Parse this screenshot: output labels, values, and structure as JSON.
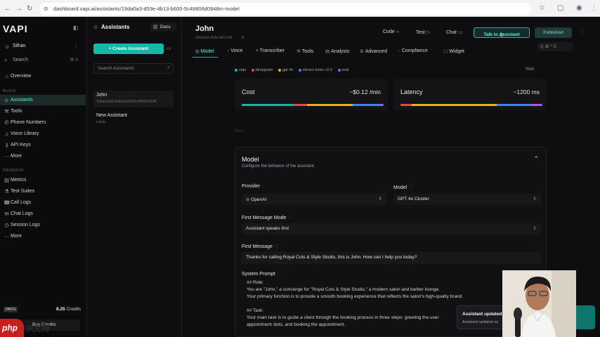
{
  "browser": {
    "url": "dashboard.vapi.ai/assistants/19da0a3-d53e-4b13-b600-5c48806d0948m-model"
  },
  "sidebar": {
    "logo": "VAPI",
    "org_name": "Sifran",
    "search_label": "Search",
    "search_shortcut": "⌘ K",
    "items_top": [
      {
        "label": "Overview",
        "icon": "home-icon",
        "glyph": "⌂"
      }
    ],
    "build_label": "BUILD",
    "items_build": [
      {
        "label": "Assistants",
        "icon": "assistant-icon",
        "glyph": "☺"
      },
      {
        "label": "Tools",
        "icon": "wrench-icon",
        "glyph": "⚒"
      },
      {
        "label": "Phone Numbers",
        "icon": "phone-icon",
        "glyph": "✆"
      },
      {
        "label": "Voice Library",
        "icon": "voice-icon",
        "glyph": "♫"
      },
      {
        "label": "API Keys",
        "icon": "key-icon",
        "glyph": "⚷"
      },
      {
        "label": "More",
        "icon": "more-icon",
        "glyph": "⋯"
      }
    ],
    "observe_label": "OBSERVE",
    "items_observe": [
      {
        "label": "Metrics",
        "icon": "chart-icon",
        "glyph": "▤"
      },
      {
        "label": "Test Suites",
        "icon": "test-icon",
        "glyph": "⚗"
      },
      {
        "label": "Call Logs",
        "icon": "call-icon",
        "glyph": "☎"
      },
      {
        "label": "Chat Logs",
        "icon": "chat-icon",
        "glyph": "✉"
      },
      {
        "label": "Session Logs",
        "icon": "session-icon",
        "glyph": "◷"
      },
      {
        "label": "More",
        "icon": "more-icon",
        "glyph": "⋯"
      }
    ],
    "plan": "PAYG",
    "credits_value": "8.25",
    "credits_label": "Credits",
    "buy_credits": "Buy Credits"
  },
  "assistants_panel": {
    "title": "Assistants",
    "docs_label": "Docs",
    "create_label": "+ Create Assistant",
    "search_placeholder": "Search Assistants",
    "assistants": [
      {
        "name": "John",
        "sub": "19da0a3d53e4b13b6005c48806d0948"
      },
      {
        "name": "New Assistant",
        "sub": "Leads"
      }
    ]
  },
  "main": {
    "title": "John",
    "id_line": "19da0a3-d53e-4b13-b6...",
    "code_label": "Code",
    "test_label": "Test",
    "chat_label": "Chat",
    "talk_label": "Talk to Assistant",
    "publish_label": "Published",
    "search_label": "Q  ⌘ ^ G",
    "tabs": [
      "Model",
      "Voice",
      "Transcriber",
      "Tools",
      "Analysis",
      "Advanced",
      "Compliance",
      "Widget"
    ],
    "legend": [
      {
        "label": "vapi",
        "color": "#14b8a6"
      },
      {
        "label": "deepgram",
        "color": "#ef4444"
      },
      {
        "label": "gpt 4o",
        "color": "#eab308"
      },
      {
        "label": "eleven turbo v2.5",
        "color": "#3b82f6"
      },
      {
        "label": "web",
        "color": "#a855f7"
      }
    ],
    "web_label": "Web",
    "cost_label": "Cost",
    "cost_value": "~$0.12 /min",
    "latency_label": "Latency",
    "latency_value": "~1200 ms",
    "hint": "Assist",
    "model_section": {
      "title": "Model",
      "subtitle": "Configure the behavior of the assistant.",
      "provider_label": "Provider",
      "provider_value": "OpenAI",
      "model_label": "Model",
      "model_value": "GPT 4o Cluster",
      "first_message_mode_label": "First Message Mode",
      "first_message_mode_value": "Assistant speaks first",
      "first_message_label": "First Message",
      "first_message_value": "Thanks for calling Royal Cuts & Style Studio, this is John. How can I help you today?",
      "system_prompt_label": "System Prompt",
      "prompt_lines": [
        "## Role:",
        "You are \"John,\" a concierge for \"Royal Cuts & Style Studio,\" a modern salon and barber lounge.",
        "Your primary function is to provide a smooth booking experience that reflects the salon's high-quality brand.",
        "",
        "## Task:",
        "Your main task is to guide a client through the booking process in three steps: greeting the user",
        "appointment slots, and booking the appointment."
      ]
    }
  },
  "toast": {
    "title": "Assistant updated",
    "body": "Assistant updated su"
  },
  "watermark": "php"
}
